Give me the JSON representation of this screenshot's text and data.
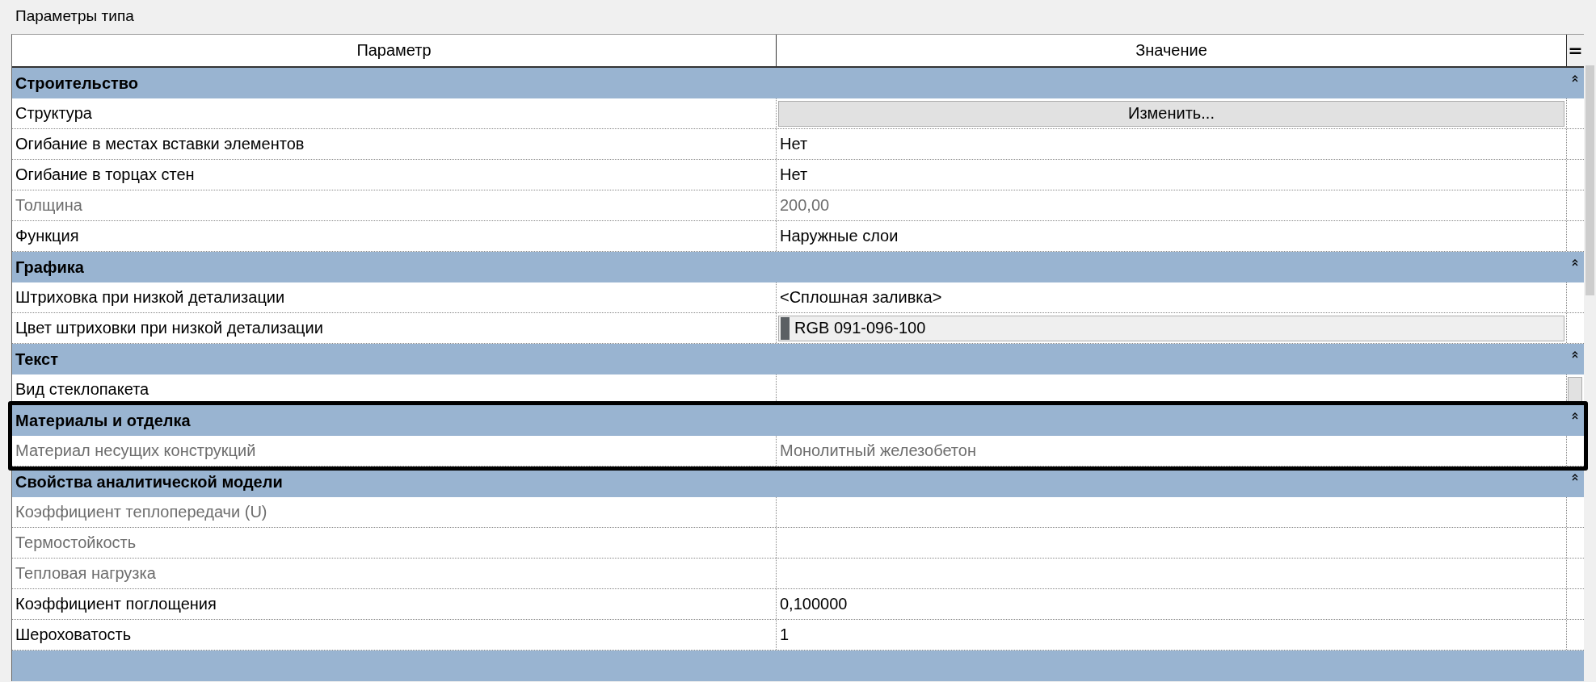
{
  "title": "Параметры типа",
  "columns": [
    "Параметр",
    "Значение",
    "="
  ],
  "groups": [
    {
      "name": "Строительство",
      "expanded": true,
      "highlighted": false,
      "rows": [
        {
          "name": "Структура",
          "kind": "button",
          "value": "Изменить...",
          "disabled": false
        },
        {
          "name": "Огибание в местах вставки элементов",
          "kind": "text",
          "value": "Нет",
          "disabled": false
        },
        {
          "name": "Огибание в торцах стен",
          "kind": "text",
          "value": "Нет",
          "disabled": false
        },
        {
          "name": "Толщина",
          "kind": "text",
          "value": "200,00",
          "disabled": true
        },
        {
          "name": "Функция",
          "kind": "text",
          "value": "Наружные слои",
          "disabled": false
        }
      ]
    },
    {
      "name": "Графика",
      "expanded": true,
      "highlighted": false,
      "rows": [
        {
          "name": "Штриховка при низкой детализации",
          "kind": "text",
          "value": "<Сплошная заливка>",
          "disabled": false
        },
        {
          "name": "Цвет штриховки при низкой детализации",
          "kind": "color",
          "value": "RGB 091-096-100",
          "color": "#5b6064",
          "disabled": false
        }
      ]
    },
    {
      "name": "Текст",
      "expanded": true,
      "highlighted": false,
      "rows": [
        {
          "name": "Вид стеклопакета",
          "kind": "picker",
          "disabled": false
        }
      ]
    },
    {
      "name": "Материалы и отделка",
      "expanded": true,
      "highlighted": true,
      "rows": [
        {
          "name": "Материал несущих конструкций",
          "kind": "text",
          "value": "Монолитный железобетон",
          "disabled": true
        }
      ]
    },
    {
      "name": "Свойства аналитической модели",
      "expanded": true,
      "highlighted": false,
      "rows": [
        {
          "name": "Коэффициент теплопередачи (U)",
          "kind": "text",
          "disabled": true
        },
        {
          "name": "Термостойкость",
          "kind": "text",
          "disabled": true
        },
        {
          "name": "Тепловая нагрузка",
          "kind": "text",
          "disabled": true
        },
        {
          "name": "Коэффициент поглощения",
          "kind": "text",
          "value": "0,100000",
          "disabled": false
        },
        {
          "name": "Шероховатость",
          "kind": "text",
          "value": "1",
          "disabled": false
        }
      ]
    },
    {
      "highlighted": false
    }
  ]
}
